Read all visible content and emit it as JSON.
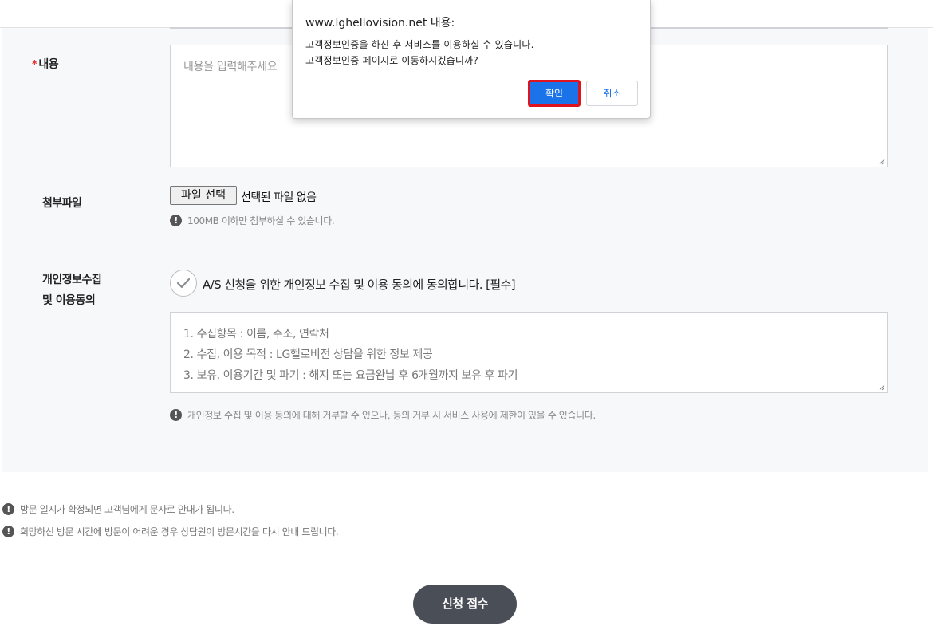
{
  "form": {
    "content_label": "내용",
    "required_mark": "*",
    "content_placeholder": "내용을 입력해주세요",
    "attachment_label": "첨부파일",
    "file_button": "파일 선택",
    "file_status": "선택된 파일 없음",
    "file_notice": "100MB 이하만 첨부하실 수 있습니다.",
    "privacy_label_line1": "개인정보수집",
    "privacy_label_line2": "및 이용동의",
    "agree_text": "A/S 신청을 위한 개인정보 수집 및 이용 동의에 동의합니다. [필수]",
    "terms": [
      "1. 수집항목 : 이름, 주소, 연락처",
      "2. 수집, 이용 목적 : LG헬로비전 상담을 위한 정보 제공",
      "3. 보유, 이용기간 및 파기 : 해지 또는 요금완납 후 6개월까지 보유 후 파기"
    ],
    "privacy_notice": "개인정보 수집 및 이용 동의에 대해 거부할 수 있으나, 동의 거부 시 서비스 사용에 제한이 있을 수 있습니다."
  },
  "notices": [
    "방문 일시가 확정되면 고객님에게 문자로 안내가 됩니다.",
    "희망하신 방문 시간에 방문이 어려운 경우 상담원이 방문시간을 다시 안내 드립니다."
  ],
  "submit_label": "신청 접수",
  "dialog": {
    "title": "www.lghellovision.net 내용:",
    "message_line1": "고객정보인증을 하신 후 서비스를 이용하실 수 있습니다.",
    "message_line2": "고객정보인증 페이지로 이동하시겠습니까?",
    "ok_label": "확인",
    "cancel_label": "취소"
  },
  "colors": {
    "accent": "#1a73e8",
    "highlight_border": "#e0141e",
    "submit_bg": "#4a4e57",
    "required": "#e5322d"
  },
  "icons": {
    "notice": "exclamation-circle-icon",
    "check": "checkmark-icon",
    "resize": "resize-handle-icon"
  }
}
